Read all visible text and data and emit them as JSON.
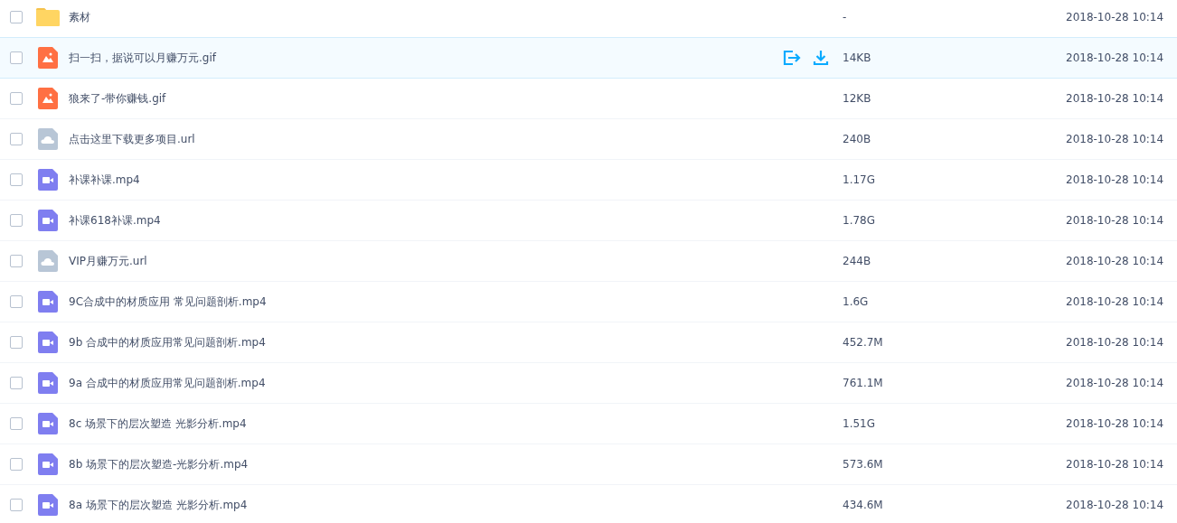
{
  "files": [
    {
      "kind": "folder",
      "name": "素材",
      "size": "-",
      "modified": "2018-10-28 10:14",
      "checked": false,
      "hovered": false
    },
    {
      "kind": "image",
      "name": "扫一扫，据说可以月赚万元.gif",
      "size": "14KB",
      "modified": "2018-10-28 10:14",
      "checked": false,
      "hovered": true
    },
    {
      "kind": "image",
      "name": "狼来了-带你赚钱.gif",
      "size": "12KB",
      "modified": "2018-10-28 10:14",
      "checked": false,
      "hovered": false
    },
    {
      "kind": "link",
      "name": "点击这里下载更多项目.url",
      "size": "240B",
      "modified": "2018-10-28 10:14",
      "checked": false,
      "hovered": false
    },
    {
      "kind": "video",
      "name": "补课补课.mp4",
      "size": "1.17G",
      "modified": "2018-10-28 10:14",
      "checked": false,
      "hovered": false
    },
    {
      "kind": "video",
      "name": "补课618补课.mp4",
      "size": "1.78G",
      "modified": "2018-10-28 10:14",
      "checked": false,
      "hovered": false
    },
    {
      "kind": "link",
      "name": "VIP月赚万元.url",
      "size": "244B",
      "modified": "2018-10-28 10:14",
      "checked": false,
      "hovered": false
    },
    {
      "kind": "video",
      "name": "9C合成中的材质应用 常见问题剖析.mp4",
      "size": "1.6G",
      "modified": "2018-10-28 10:14",
      "checked": false,
      "hovered": false
    },
    {
      "kind": "video",
      "name": "9b 合成中的材质应用常见问题剖析.mp4",
      "size": "452.7M",
      "modified": "2018-10-28 10:14",
      "checked": false,
      "hovered": false
    },
    {
      "kind": "video",
      "name": "9a 合成中的材质应用常见问题剖析.mp4",
      "size": "761.1M",
      "modified": "2018-10-28 10:14",
      "checked": false,
      "hovered": false
    },
    {
      "kind": "video",
      "name": "8c 场景下的层次塑造 光影分析.mp4",
      "size": "1.51G",
      "modified": "2018-10-28 10:14",
      "checked": false,
      "hovered": false
    },
    {
      "kind": "video",
      "name": "8b 场景下的层次塑造-光影分析.mp4",
      "size": "573.6M",
      "modified": "2018-10-28 10:14",
      "checked": false,
      "hovered": false
    },
    {
      "kind": "video",
      "name": "8a 场景下的层次塑造 光影分析.mp4",
      "size": "434.6M",
      "modified": "2018-10-28 10:14",
      "checked": false,
      "hovered": false
    }
  ]
}
